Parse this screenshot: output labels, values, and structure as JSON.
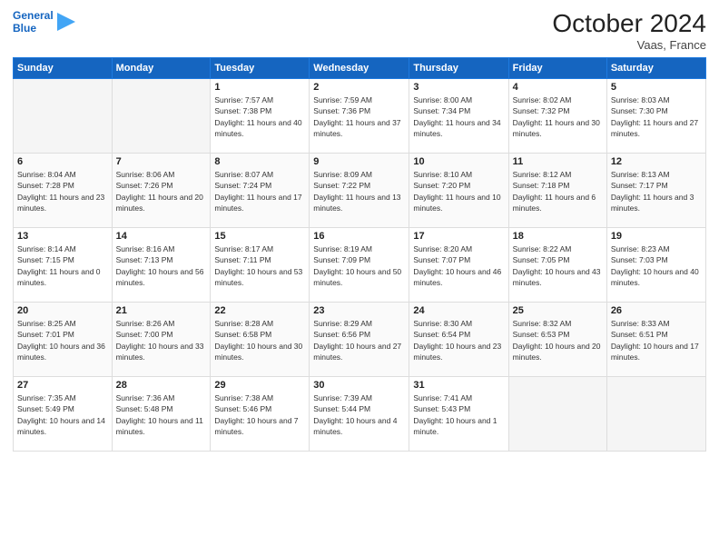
{
  "header": {
    "logo_line1": "General",
    "logo_line2": "Blue",
    "month": "October 2024",
    "location": "Vaas, France"
  },
  "weekdays": [
    "Sunday",
    "Monday",
    "Tuesday",
    "Wednesday",
    "Thursday",
    "Friday",
    "Saturday"
  ],
  "weeks": [
    [
      {
        "day": "",
        "info": ""
      },
      {
        "day": "",
        "info": ""
      },
      {
        "day": "1",
        "info": "Sunrise: 7:57 AM\nSunset: 7:38 PM\nDaylight: 11 hours and 40 minutes."
      },
      {
        "day": "2",
        "info": "Sunrise: 7:59 AM\nSunset: 7:36 PM\nDaylight: 11 hours and 37 minutes."
      },
      {
        "day": "3",
        "info": "Sunrise: 8:00 AM\nSunset: 7:34 PM\nDaylight: 11 hours and 34 minutes."
      },
      {
        "day": "4",
        "info": "Sunrise: 8:02 AM\nSunset: 7:32 PM\nDaylight: 11 hours and 30 minutes."
      },
      {
        "day": "5",
        "info": "Sunrise: 8:03 AM\nSunset: 7:30 PM\nDaylight: 11 hours and 27 minutes."
      }
    ],
    [
      {
        "day": "6",
        "info": "Sunrise: 8:04 AM\nSunset: 7:28 PM\nDaylight: 11 hours and 23 minutes."
      },
      {
        "day": "7",
        "info": "Sunrise: 8:06 AM\nSunset: 7:26 PM\nDaylight: 11 hours and 20 minutes."
      },
      {
        "day": "8",
        "info": "Sunrise: 8:07 AM\nSunset: 7:24 PM\nDaylight: 11 hours and 17 minutes."
      },
      {
        "day": "9",
        "info": "Sunrise: 8:09 AM\nSunset: 7:22 PM\nDaylight: 11 hours and 13 minutes."
      },
      {
        "day": "10",
        "info": "Sunrise: 8:10 AM\nSunset: 7:20 PM\nDaylight: 11 hours and 10 minutes."
      },
      {
        "day": "11",
        "info": "Sunrise: 8:12 AM\nSunset: 7:18 PM\nDaylight: 11 hours and 6 minutes."
      },
      {
        "day": "12",
        "info": "Sunrise: 8:13 AM\nSunset: 7:17 PM\nDaylight: 11 hours and 3 minutes."
      }
    ],
    [
      {
        "day": "13",
        "info": "Sunrise: 8:14 AM\nSunset: 7:15 PM\nDaylight: 11 hours and 0 minutes."
      },
      {
        "day": "14",
        "info": "Sunrise: 8:16 AM\nSunset: 7:13 PM\nDaylight: 10 hours and 56 minutes."
      },
      {
        "day": "15",
        "info": "Sunrise: 8:17 AM\nSunset: 7:11 PM\nDaylight: 10 hours and 53 minutes."
      },
      {
        "day": "16",
        "info": "Sunrise: 8:19 AM\nSunset: 7:09 PM\nDaylight: 10 hours and 50 minutes."
      },
      {
        "day": "17",
        "info": "Sunrise: 8:20 AM\nSunset: 7:07 PM\nDaylight: 10 hours and 46 minutes."
      },
      {
        "day": "18",
        "info": "Sunrise: 8:22 AM\nSunset: 7:05 PM\nDaylight: 10 hours and 43 minutes."
      },
      {
        "day": "19",
        "info": "Sunrise: 8:23 AM\nSunset: 7:03 PM\nDaylight: 10 hours and 40 minutes."
      }
    ],
    [
      {
        "day": "20",
        "info": "Sunrise: 8:25 AM\nSunset: 7:01 PM\nDaylight: 10 hours and 36 minutes."
      },
      {
        "day": "21",
        "info": "Sunrise: 8:26 AM\nSunset: 7:00 PM\nDaylight: 10 hours and 33 minutes."
      },
      {
        "day": "22",
        "info": "Sunrise: 8:28 AM\nSunset: 6:58 PM\nDaylight: 10 hours and 30 minutes."
      },
      {
        "day": "23",
        "info": "Sunrise: 8:29 AM\nSunset: 6:56 PM\nDaylight: 10 hours and 27 minutes."
      },
      {
        "day": "24",
        "info": "Sunrise: 8:30 AM\nSunset: 6:54 PM\nDaylight: 10 hours and 23 minutes."
      },
      {
        "day": "25",
        "info": "Sunrise: 8:32 AM\nSunset: 6:53 PM\nDaylight: 10 hours and 20 minutes."
      },
      {
        "day": "26",
        "info": "Sunrise: 8:33 AM\nSunset: 6:51 PM\nDaylight: 10 hours and 17 minutes."
      }
    ],
    [
      {
        "day": "27",
        "info": "Sunrise: 7:35 AM\nSunset: 5:49 PM\nDaylight: 10 hours and 14 minutes."
      },
      {
        "day": "28",
        "info": "Sunrise: 7:36 AM\nSunset: 5:48 PM\nDaylight: 10 hours and 11 minutes."
      },
      {
        "day": "29",
        "info": "Sunrise: 7:38 AM\nSunset: 5:46 PM\nDaylight: 10 hours and 7 minutes."
      },
      {
        "day": "30",
        "info": "Sunrise: 7:39 AM\nSunset: 5:44 PM\nDaylight: 10 hours and 4 minutes."
      },
      {
        "day": "31",
        "info": "Sunrise: 7:41 AM\nSunset: 5:43 PM\nDaylight: 10 hours and 1 minute."
      },
      {
        "day": "",
        "info": ""
      },
      {
        "day": "",
        "info": ""
      }
    ]
  ]
}
